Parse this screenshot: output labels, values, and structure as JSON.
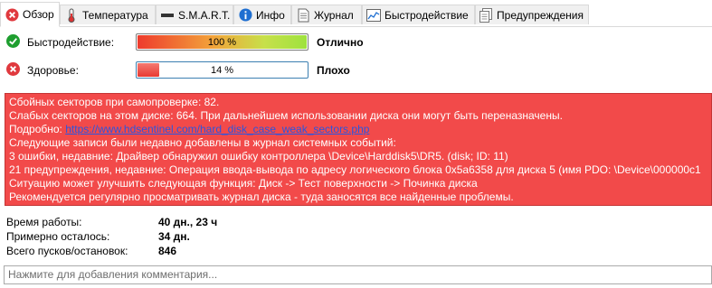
{
  "tabs": [
    {
      "label": "Обзор",
      "icon": "x-circle-icon"
    },
    {
      "label": "Температура",
      "icon": "thermometer-icon"
    },
    {
      "label": "S.M.A.R.T.",
      "icon": "smart-bar-icon"
    },
    {
      "label": "Инфо",
      "icon": "info-icon"
    },
    {
      "label": "Журнал",
      "icon": "document-icon"
    },
    {
      "label": "Быстродействие",
      "icon": "performance-chart-icon"
    },
    {
      "label": "Предупреждения",
      "icon": "warnings-icon"
    }
  ],
  "performance": {
    "label": "Быстродействие:",
    "bar_text": "100 %",
    "level": 100,
    "verdict": "Отлично"
  },
  "health": {
    "label": "Здоровье:",
    "bar_text": "14 %",
    "level": 14,
    "verdict": "Плохо"
  },
  "alert": {
    "line1": "Сбойных секторов при самопроверке: 82.",
    "line2": "Слабых секторов на этом диске: 664. При дальнейшем использовании диска они могут быть переназначены.",
    "line3_prefix": "Подробно: ",
    "line3_link": "https://www.hdsentinel.com/hard_disk_case_weak_sectors.php",
    "line4": "Следующие записи были недавно добавлены в журнал системных событий:",
    "line5": "3 ошибки, недавние: Драйвер обнаружил ошибку контроллера \\Device\\Harddisk5\\DR5. (disk; ID: 11)",
    "line6": "21 предупреждения, недавние: Операция ввода-вывода по адресу логического блока 0x5a6358 для диска 5 (имя PDO: \\Device\\000000c1",
    "line7": "Ситуацию может улучшить следующая функция: Диск -> Тест поверхности -> Починка диска",
    "line8": "Рекомендуется регулярно просматривать журнал диска - туда заносятся все найденные проблемы."
  },
  "info": {
    "uptime_label": "Время работы:",
    "uptime_value": "40 дн., 23 ч",
    "remaining_label": "Примерно осталось:",
    "remaining_value": "34 дн.",
    "starts_label": "Всего пусков/остановок:",
    "starts_value": "846"
  },
  "comment": {
    "placeholder": "Нажмите для добавления комментария..."
  },
  "colors": {
    "alert_bg": "#f24a4a",
    "ok": "#1e9e2f",
    "bad": "#e0393e",
    "link": "#2a55e0"
  }
}
